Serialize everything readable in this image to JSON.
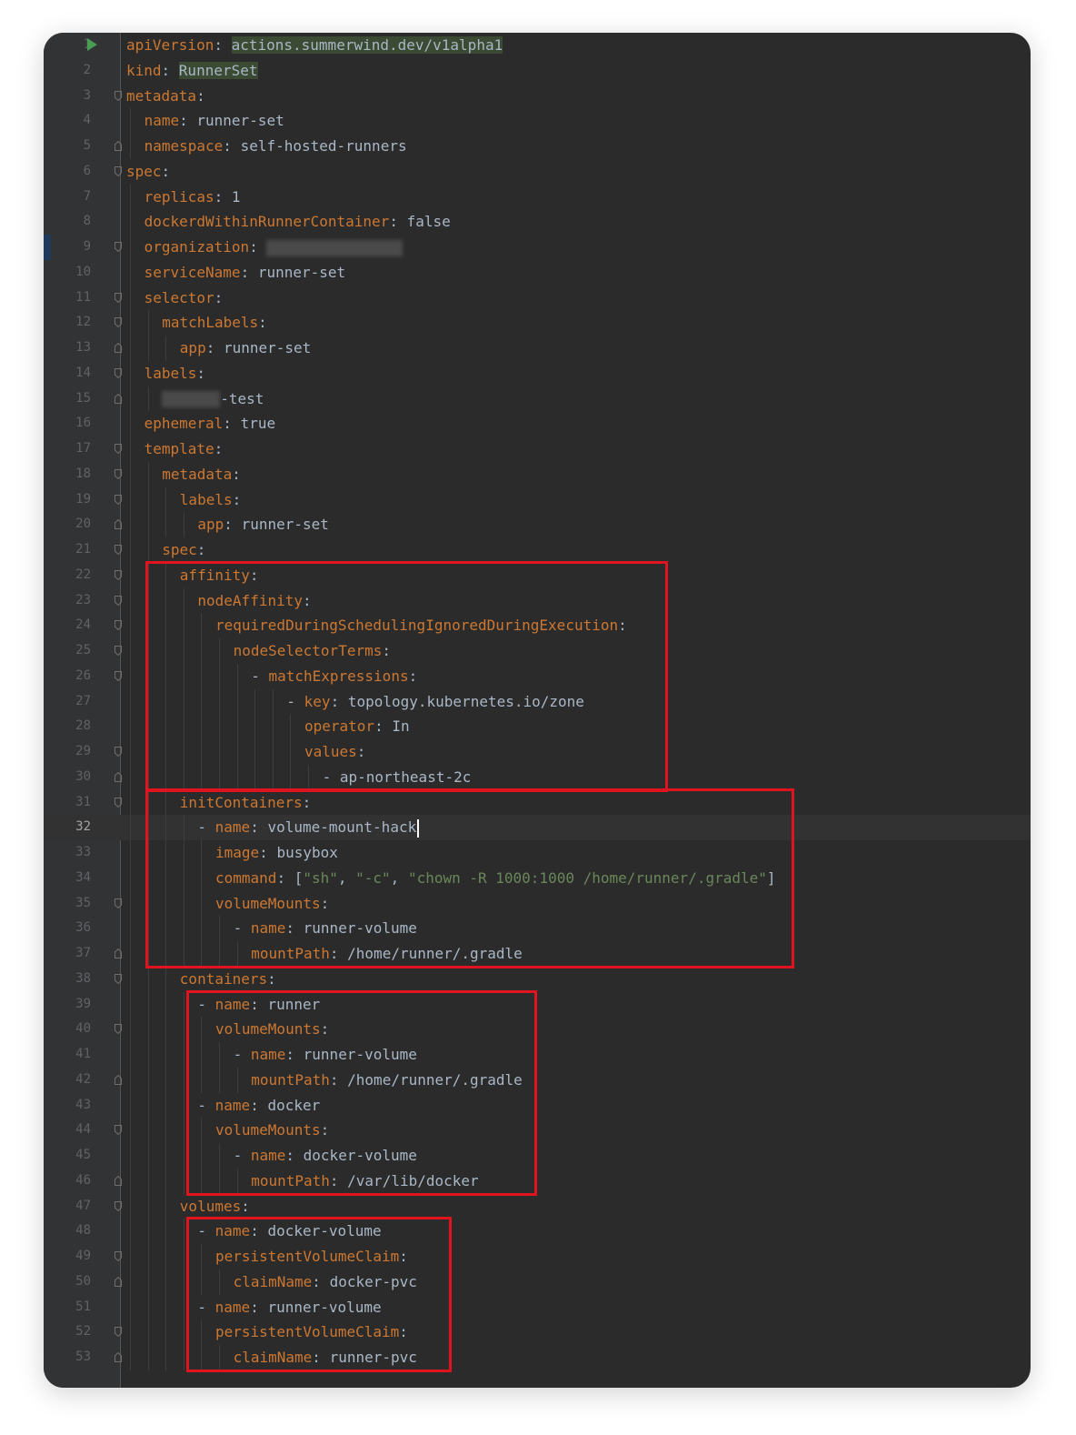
{
  "editor": {
    "language": "yaml",
    "current_line": 32,
    "lines": [
      {
        "n": 1,
        "indent": 0,
        "key": "apiVersion",
        "value": "actions.summerwind.dev/v1alpha1",
        "value_highlight": true,
        "run": true
      },
      {
        "n": 2,
        "indent": 0,
        "key": "kind",
        "value": "RunnerSet",
        "value_highlight": true
      },
      {
        "n": 3,
        "indent": 0,
        "key": "metadata",
        "value": ""
      },
      {
        "n": 4,
        "indent": 1,
        "key": "name",
        "value": "runner-set"
      },
      {
        "n": 5,
        "indent": 1,
        "key": "namespace",
        "value": "self-hosted-runners"
      },
      {
        "n": 6,
        "indent": 0,
        "key": "spec",
        "value": ""
      },
      {
        "n": 7,
        "indent": 1,
        "key": "replicas",
        "value": "1"
      },
      {
        "n": 8,
        "indent": 1,
        "key": "dockerdWithinRunnerContainer",
        "value": "false"
      },
      {
        "n": 9,
        "indent": 1,
        "key": "organization",
        "value": "",
        "redacted": true
      },
      {
        "n": 10,
        "indent": 1,
        "key": "serviceName",
        "value": "runner-set"
      },
      {
        "n": 11,
        "indent": 1,
        "key": "selector",
        "value": ""
      },
      {
        "n": 12,
        "indent": 2,
        "key": "matchLabels",
        "value": ""
      },
      {
        "n": 13,
        "indent": 3,
        "key": "app",
        "value": "runner-set"
      },
      {
        "n": 14,
        "indent": 1,
        "key": "labels",
        "value": ""
      },
      {
        "n": 15,
        "indent": 2,
        "key": "",
        "value": "-test",
        "redacted_prefix": true
      },
      {
        "n": 16,
        "indent": 1,
        "key": "ephemeral",
        "value": "true"
      },
      {
        "n": 17,
        "indent": 1,
        "key": "template",
        "value": ""
      },
      {
        "n": 18,
        "indent": 2,
        "key": "metadata",
        "value": ""
      },
      {
        "n": 19,
        "indent": 3,
        "key": "labels",
        "value": ""
      },
      {
        "n": 20,
        "indent": 4,
        "key": "app",
        "value": "runner-set"
      },
      {
        "n": 21,
        "indent": 2,
        "key": "spec",
        "value": ""
      },
      {
        "n": 22,
        "indent": 3,
        "key": "affinity",
        "value": ""
      },
      {
        "n": 23,
        "indent": 4,
        "key": "nodeAffinity",
        "value": ""
      },
      {
        "n": 24,
        "indent": 5,
        "key": "requiredDuringSchedulingIgnoredDuringExecution",
        "value": ""
      },
      {
        "n": 25,
        "indent": 6,
        "key": "nodeSelectorTerms",
        "value": ""
      },
      {
        "n": 26,
        "indent": 7,
        "dash": true,
        "key": "matchExpressions",
        "value": ""
      },
      {
        "n": 27,
        "indent": 9,
        "dash": true,
        "key": "key",
        "value": "topology.kubernetes.io/zone"
      },
      {
        "n": 28,
        "indent": 10,
        "key": "operator",
        "value": "In"
      },
      {
        "n": 29,
        "indent": 10,
        "key": "values",
        "value": ""
      },
      {
        "n": 30,
        "indent": 11,
        "dash": true,
        "key": "",
        "value": "ap-northeast-2c"
      },
      {
        "n": 31,
        "indent": 3,
        "key": "initContainers",
        "value": ""
      },
      {
        "n": 32,
        "indent": 4,
        "dash": true,
        "key": "name",
        "value": "volume-mount-hack",
        "caret": true
      },
      {
        "n": 33,
        "indent": 5,
        "key": "image",
        "value": "busybox"
      },
      {
        "n": 34,
        "indent": 5,
        "key": "command",
        "value": "[\"sh\", \"-c\", \"chown -R 1000:1000 /home/runner/.gradle\"]",
        "array": [
          "sh",
          "-c",
          "chown -R 1000:1000 /home/runner/.gradle"
        ]
      },
      {
        "n": 35,
        "indent": 5,
        "key": "volumeMounts",
        "value": ""
      },
      {
        "n": 36,
        "indent": 6,
        "dash": true,
        "key": "name",
        "value": "runner-volume"
      },
      {
        "n": 37,
        "indent": 7,
        "key": "mountPath",
        "value": "/home/runner/.gradle"
      },
      {
        "n": 38,
        "indent": 3,
        "key": "containers",
        "value": ""
      },
      {
        "n": 39,
        "indent": 4,
        "dash": true,
        "key": "name",
        "value": "runner"
      },
      {
        "n": 40,
        "indent": 5,
        "key": "volumeMounts",
        "value": ""
      },
      {
        "n": 41,
        "indent": 6,
        "dash": true,
        "key": "name",
        "value": "runner-volume"
      },
      {
        "n": 42,
        "indent": 7,
        "key": "mountPath",
        "value": "/home/runner/.gradle"
      },
      {
        "n": 43,
        "indent": 4,
        "dash": true,
        "key": "name",
        "value": "docker"
      },
      {
        "n": 44,
        "indent": 5,
        "key": "volumeMounts",
        "value": ""
      },
      {
        "n": 45,
        "indent": 6,
        "dash": true,
        "key": "name",
        "value": "docker-volume"
      },
      {
        "n": 46,
        "indent": 7,
        "key": "mountPath",
        "value": "/var/lib/docker"
      },
      {
        "n": 47,
        "indent": 3,
        "key": "volumes",
        "value": ""
      },
      {
        "n": 48,
        "indent": 4,
        "dash": true,
        "key": "name",
        "value": "docker-volume"
      },
      {
        "n": 49,
        "indent": 5,
        "key": "persistentVolumeClaim",
        "value": ""
      },
      {
        "n": 50,
        "indent": 6,
        "key": "claimName",
        "value": "docker-pvc"
      },
      {
        "n": 51,
        "indent": 4,
        "dash": true,
        "key": "name",
        "value": "runner-volume"
      },
      {
        "n": 52,
        "indent": 5,
        "key": "persistentVolumeClaim",
        "value": ""
      },
      {
        "n": 53,
        "indent": 6,
        "key": "claimName",
        "value": "runner-pvc"
      }
    ]
  },
  "colors": {
    "background": "#2b2b2b",
    "gutter": "#313335",
    "key": "#cc7832",
    "value": "#a9b7c6",
    "string": "#6a8759",
    "line_number": "#606366",
    "highlight_box": "#e0141e"
  },
  "annotations": [
    {
      "label": "affinity-box",
      "from_line": 22,
      "to_line": 30
    },
    {
      "label": "initcontainers-box",
      "from_line": 31,
      "to_line": 37
    },
    {
      "label": "containers-box",
      "from_line": 39,
      "to_line": 46
    },
    {
      "label": "volumes-box",
      "from_line": 48,
      "to_line": 53
    }
  ]
}
